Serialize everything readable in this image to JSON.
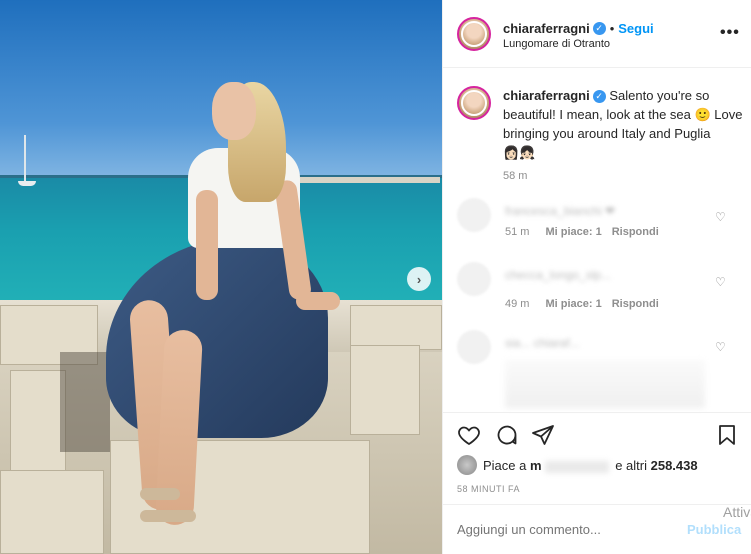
{
  "header": {
    "username": "chiaraferragni",
    "verified_icon": "verified-badge-icon",
    "separator": "•",
    "follow_label": "Segui",
    "location": "Lungomare di Otranto",
    "more_icon": "more-options-icon",
    "more_glyph": "•••"
  },
  "photo": {
    "next_icon": "chevron-right-icon",
    "next_glyph": "›"
  },
  "caption": {
    "username": "chiaraferragni",
    "text": "Salento you're so beautiful! I mean, look at the sea 🙂 Love bringing you around Italy and Puglia 👩🏻‍👧🏻",
    "time": "58 m"
  },
  "comments": [
    {
      "text": "francesca_bianchi ❤",
      "time": "51 m",
      "likes": "Mi piace: 1",
      "reply": "Rispondi"
    },
    {
      "text": "checca_longo_slp...",
      "time": "49 m",
      "likes": "Mi piace: 1",
      "reply": "Rispondi"
    },
    {
      "text": "sia... chiaraf...",
      "time": "",
      "likes": "",
      "reply": ""
    }
  ],
  "actions": {
    "like_icon": "heart-icon",
    "comment_icon": "comment-icon",
    "share_icon": "send-icon",
    "save_icon": "bookmark-icon"
  },
  "likes": {
    "prefix": "Piace a",
    "name_initial": "m",
    "suffix": "e altri",
    "count": "258.438"
  },
  "timeago": "58 MINUTI FA",
  "add_comment": {
    "placeholder": "Aggiungi un commento...",
    "publish_label": "Pubblica"
  },
  "overlay": {
    "activate_text": "Attiva"
  }
}
